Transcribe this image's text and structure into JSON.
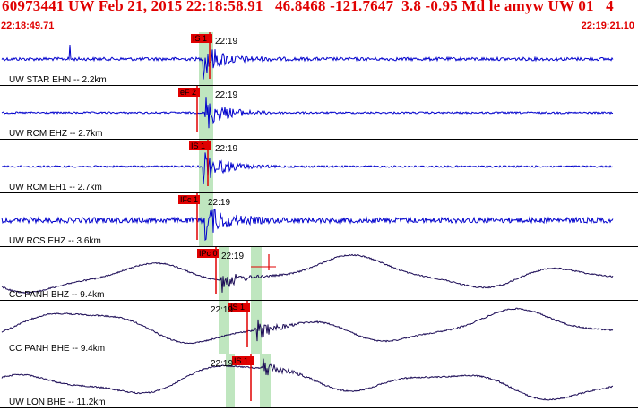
{
  "header": {
    "title": "60973441 UW Feb 21, 2015 22:18:58.91   46.8468 -121.7647  3.8 -0.95 Md le amyw UW 01   4",
    "start_time": "22:18:49.71",
    "end_time": "22:19:21.10"
  },
  "colors": {
    "header_text": "#e00000",
    "short_period_trace": "#0000cc",
    "broadband_trace": "#1a0a55",
    "pick_flag": "#e00000",
    "pick_window": "#bfe6bf",
    "divider": "#000000"
  },
  "panels": [
    {
      "label": "UW STAR EHN -- 2.2km",
      "pick": "IS 1",
      "time_mark": "22:19",
      "style": "sp",
      "noise": 0.35
    },
    {
      "label": "UW RCM EHZ -- 2.7km",
      "pick": "eF 2",
      "time_mark": "22:19",
      "style": "sp",
      "noise": 0.12
    },
    {
      "label": "UW RCM EH1 -- 2.7km",
      "pick": "IS 1",
      "time_mark": "22:19",
      "style": "sp",
      "noise": 0.12
    },
    {
      "label": "UW RCS EHZ -- 3.6km",
      "pick": "IFc 1",
      "time_mark": "22:19",
      "style": "sp",
      "noise": 0.7
    },
    {
      "label": "CC PANH BHZ -- 9.4km",
      "pick": "IPc 0",
      "time_mark": "22:19",
      "style": "bb",
      "noise": 0.0
    },
    {
      "label": "CC PANH BHE -- 9.4km",
      "pick": "IS 1",
      "time_mark": "22:19",
      "style": "bb",
      "noise": 0.0
    },
    {
      "label": "UW LON BHE -- 11.2km",
      "pick": "IS 1",
      "time_mark": "22:19",
      "style": "bb",
      "noise": 0.0
    }
  ]
}
